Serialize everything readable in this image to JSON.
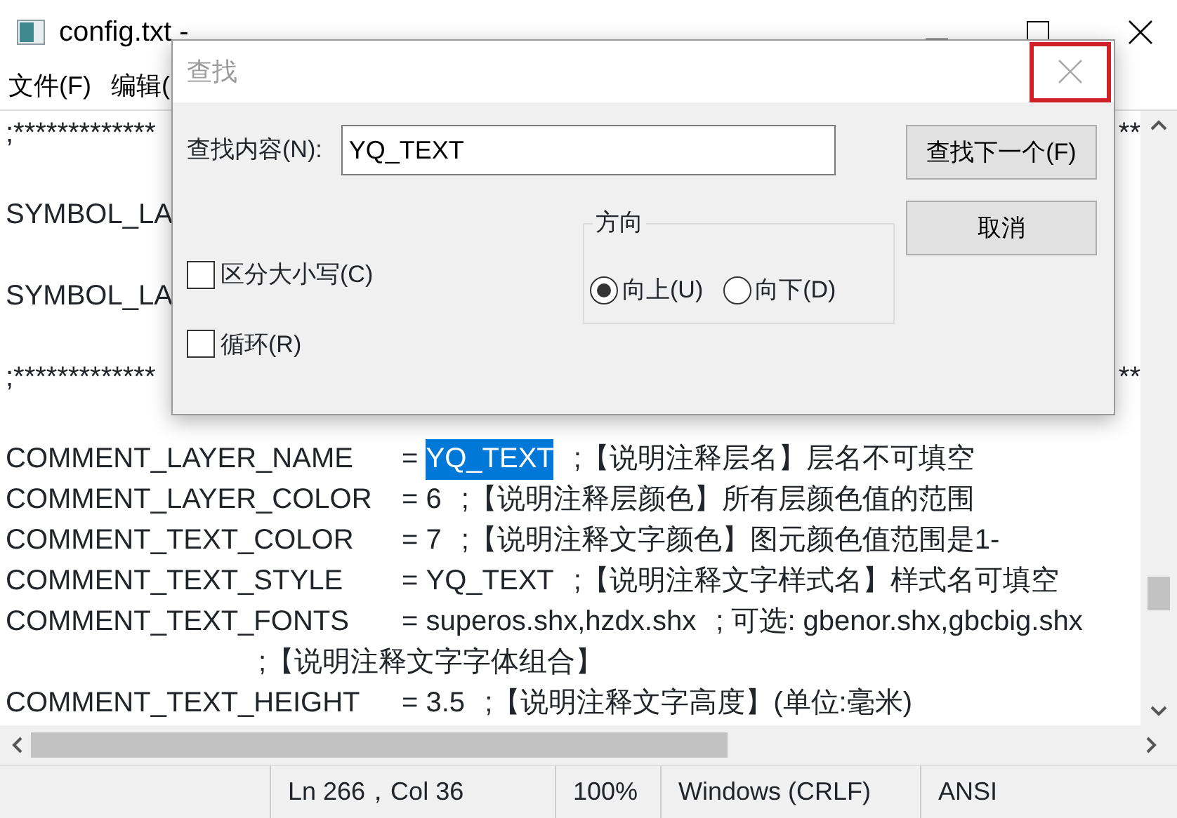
{
  "window": {
    "title": "config.txt -"
  },
  "menu": [
    "文件(F)",
    "编辑("
  ],
  "editor": {
    "lines": [
      {
        "kind": "split",
        "left": ";*************",
        "right": "**"
      },
      {
        "kind": "gap"
      },
      {
        "kind": "split",
        "left": "SYMBOL_LA"
      },
      {
        "kind": "gap"
      },
      {
        "kind": "split",
        "left": "SYMBOL_LA"
      },
      {
        "kind": "gap"
      },
      {
        "kind": "split",
        "left": ";*************",
        "right": "**"
      },
      {
        "kind": "gap"
      },
      {
        "kind": "entry",
        "key": "COMMENT_LAYER_NAME",
        "sign": "=",
        "value": "YQ_TEXT",
        "value_selected": true,
        "comment": ";【说明注释层名】层名不可填空"
      },
      {
        "kind": "entry",
        "key": "COMMENT_LAYER_COLOR",
        "sign": "=",
        "value": "6",
        "value_selected": false,
        "comment": ";【说明注释层颜色】所有层颜色值的范围"
      },
      {
        "kind": "entry",
        "key": "COMMENT_TEXT_COLOR",
        "sign": "=",
        "value": "7",
        "value_selected": false,
        "comment": ";【说明注释文字颜色】图元颜色值范围是1-"
      },
      {
        "kind": "entry",
        "key": "COMMENT_TEXT_STYLE",
        "sign": "=",
        "value": "YQ_TEXT",
        "value_selected": false,
        "comment": ";【说明注释文字样式名】样式名可填空"
      },
      {
        "kind": "entry",
        "key": "COMMENT_TEXT_FONTS",
        "sign": "=",
        "value": "superos.shx,hzdx.shx",
        "value_selected": false,
        "comment": "; 可选: gbenor.shx,gbcbig.shx"
      },
      {
        "kind": "cont",
        "comment": ";【说明注释文字字体组合】"
      },
      {
        "kind": "entry",
        "key": "COMMENT_TEXT_HEIGHT",
        "sign": "=",
        "value": "3.5",
        "value_selected": false,
        "comment": ";【说明注释文字高度】(单位:毫米)"
      }
    ]
  },
  "status_bar": [
    "Ln 266，Col 36",
    "100%",
    "Windows (CRLF)",
    "ANSI"
  ],
  "find_dialog": {
    "title": "查找",
    "find_label": "查找内容(N):",
    "find_value": "YQ_TEXT",
    "buttons": [
      "查找下一个(F)",
      "取消"
    ],
    "direction": {
      "label": "方向",
      "options": [
        {
          "label": "向上(U)",
          "selected": true
        },
        {
          "label": "向下(D)",
          "selected": false
        }
      ]
    },
    "options": [
      {
        "label": "区分大小写(C)",
        "checked": false
      },
      {
        "label": "循环(R)",
        "checked": false
      }
    ]
  }
}
